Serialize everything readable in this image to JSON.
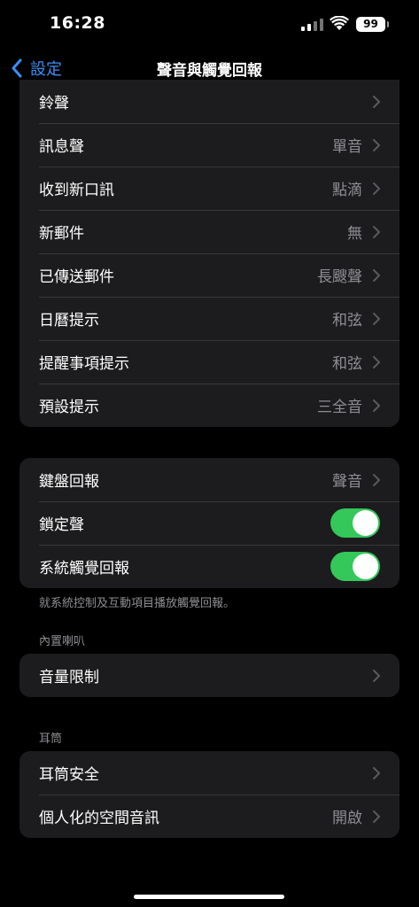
{
  "status_bar": {
    "time": "16:28",
    "battery": "99"
  },
  "nav": {
    "back_label": "設定",
    "title": "聲音與觸覺回報"
  },
  "sounds_group": [
    {
      "label": "鈴聲",
      "value": ""
    },
    {
      "label": "訊息聲",
      "value": "單音"
    },
    {
      "label": "收到新口訊",
      "value": "點滴"
    },
    {
      "label": "新郵件",
      "value": "無"
    },
    {
      "label": "已傳送郵件",
      "value": "長颼聲"
    },
    {
      "label": "日曆提示",
      "value": "和弦"
    },
    {
      "label": "提醒事項提示",
      "value": "和弦"
    },
    {
      "label": "預設提示",
      "value": "三全音"
    }
  ],
  "feedback_group": {
    "keyboard": {
      "label": "鍵盤回報",
      "value": "聲音"
    },
    "lock_sound": {
      "label": "鎖定聲",
      "on": true
    },
    "system_haptics": {
      "label": "系統觸覺回報",
      "on": true
    },
    "footnote": "就系統控制及互動項目播放觸覺回報。"
  },
  "speaker_section": {
    "header": "內置喇叭",
    "volume_limit": "音量限制"
  },
  "earbuds_section": {
    "header": "耳筒",
    "safety": "耳筒安全",
    "spatial": {
      "label": "個人化的空間音訊",
      "value": "開啟"
    }
  },
  "colors": {
    "accent": "#3a8ff7",
    "toggle_on": "#34c759",
    "cell_bg": "#1c1c1e",
    "secondary_text": "#8e8e93"
  }
}
